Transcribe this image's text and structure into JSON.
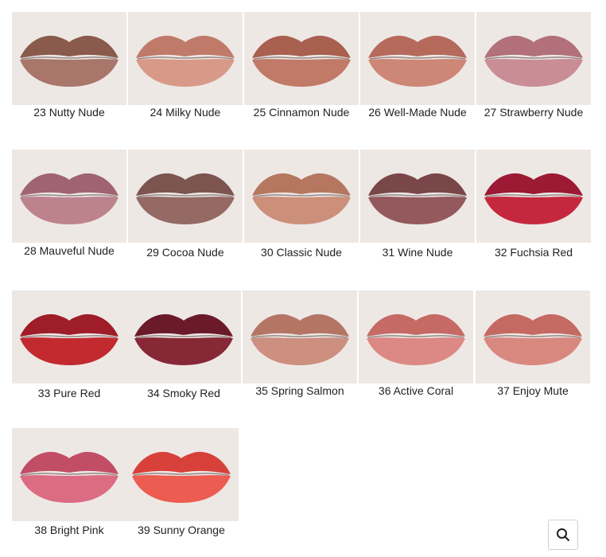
{
  "shades": [
    {
      "name": "23 Nutty Nude",
      "upper": "#8a5a4c",
      "lower": "#a8766a"
    },
    {
      "name": "24 Milky Nude",
      "upper": "#c07a69",
      "lower": "#d89a88"
    },
    {
      "name": "25 Cinnamon Nude",
      "upper": "#a9604f",
      "lower": "#c27a68"
    },
    {
      "name": "26 Well-Made Nude",
      "upper": "#b56a5c",
      "lower": "#cc8777"
    },
    {
      "name": "27 Strawberry Nude",
      "upper": "#b1707a",
      "lower": "#c98d95"
    },
    {
      "name": "28 Mauveful Nude",
      "upper": "#a06470",
      "lower": "#bd838d"
    },
    {
      "name": "29 Cocoa Nude",
      "upper": "#7c5550",
      "lower": "#956a64"
    },
    {
      "name": "30 Classic Nude",
      "upper": "#b67760",
      "lower": "#cc907a"
    },
    {
      "name": "31 Wine Nude",
      "upper": "#7a4749",
      "lower": "#93595c"
    },
    {
      "name": "32 Fuchsia Red",
      "upper": "#9c1a33",
      "lower": "#c5283e"
    },
    {
      "name": "33 Pure Red",
      "upper": "#9e1d28",
      "lower": "#c22a30"
    },
    {
      "name": "34 Smoky Red",
      "upper": "#6a1a28",
      "lower": "#862835"
    },
    {
      "name": "35 Spring Salmon",
      "upper": "#b47565",
      "lower": "#cc8f80"
    },
    {
      "name": "36 Active Coral",
      "upper": "#c56a64",
      "lower": "#dc8884"
    },
    {
      "name": "37 Enjoy Mute",
      "upper": "#c46a62",
      "lower": "#d98880"
    },
    {
      "name": "38 Bright Pink",
      "upper": "#c24e66",
      "lower": "#dc6c82"
    },
    {
      "name": "39 Sunny Orange",
      "upper": "#d7413a",
      "lower": "#ec5c50"
    }
  ],
  "search_button": {
    "icon": "search-icon"
  }
}
